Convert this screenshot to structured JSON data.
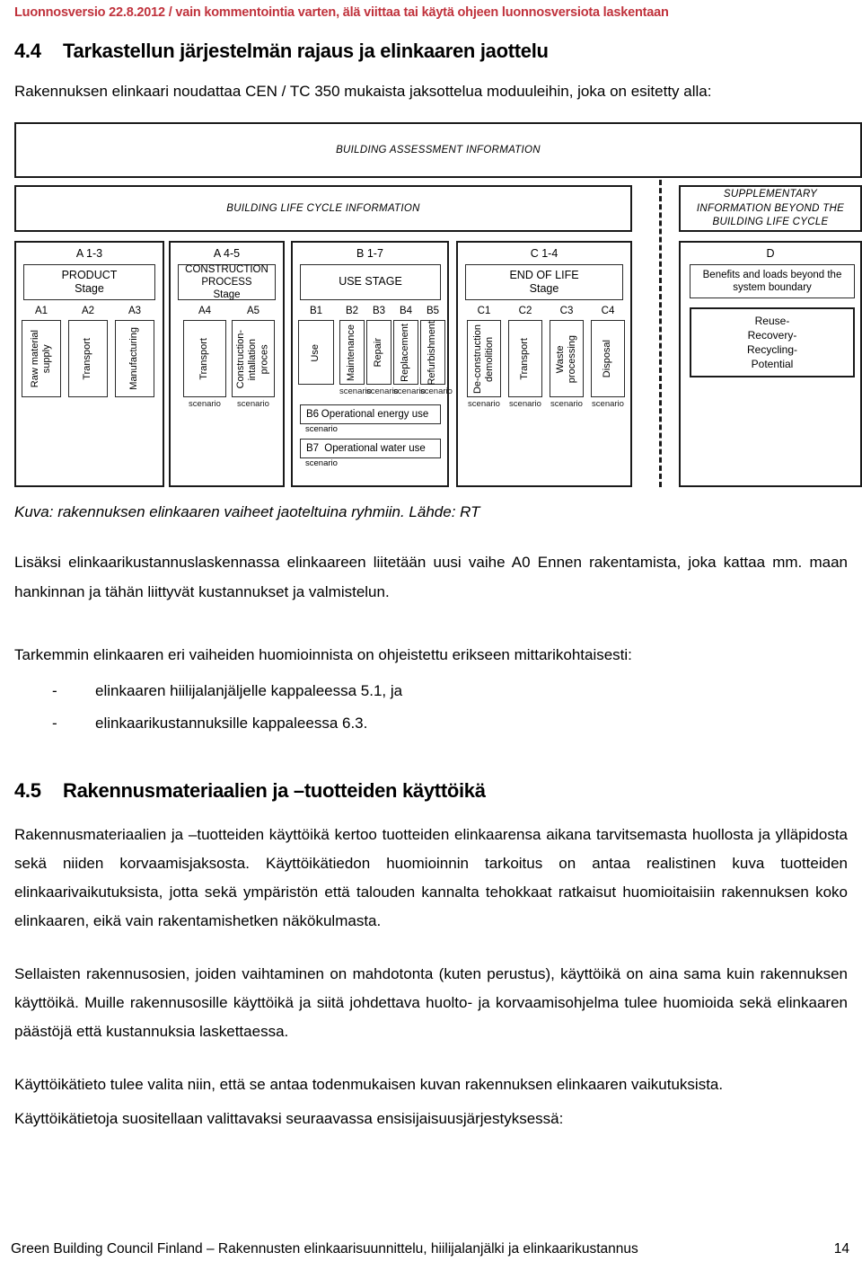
{
  "draft_banner": "Luonnosversio 22.8.2012 / vain kommentointia varten, älä viittaa tai käytä ohjeen luonnosversiota laskentaan",
  "section_44": {
    "number": "4.4",
    "title": "Tarkastellun järjestelmän rajaus ja elinkaaren jaottelu",
    "intro": "Rakennuksen elinkaari noudattaa CEN / TC 350 mukaista jaksottelua moduuleihin, joka on esitetty alla:",
    "caption": "Kuva: rakennuksen elinkaaren vaiheet jaoteltuina ryhmiin. Lähde: RT",
    "para_a0": "Lisäksi elinkaarikustannuslaskennassa elinkaareen liitetään uusi vaihe A0 Ennen rakentamista, joka kattaa mm. maan hankinnan ja tähän liittyvät kustannukset ja valmistelun.",
    "para_metrics": "Tarkemmin elinkaaren eri vaiheiden huomioinnista on ohjeistettu erikseen mittarikohtaisesti:",
    "bullets": [
      {
        "dash": "-",
        "text": "elinkaaren hiilijalanjäljelle kappaleessa 5.1, ja"
      },
      {
        "dash": "-",
        "text": "elinkaarikustannuksille kappaleessa 6.3."
      }
    ]
  },
  "figure": {
    "assessment_header": "BUILDING ASSESSMENT INFORMATION",
    "lifecycle_header": "BUILDING LIFE CYCLE INFORMATION",
    "supplementary_header": "SUPPLEMENTARY\nINFORMATION BEYOND THE\nBUILDING LIFE CYCLE",
    "groups": [
      {
        "code": "A 1-3",
        "stage_title": "PRODUCT\nStage",
        "modules": [
          {
            "code": "A1",
            "label": "Raw material\nsupply",
            "scenario": ""
          },
          {
            "code": "A2",
            "label": "Transport",
            "scenario": ""
          },
          {
            "code": "A3",
            "label": "Manufacturing",
            "scenario": ""
          }
        ]
      },
      {
        "code": "A 4-5",
        "stage_title": "CONSTRUCTION\nPROCESS\nStage",
        "modules": [
          {
            "code": "A4",
            "label": "Transport",
            "scenario": "scenario"
          },
          {
            "code": "A5",
            "label": "Construction-\nintallation\nproces",
            "scenario": "scenario"
          }
        ]
      },
      {
        "code": "B 1-7",
        "stage_title": "USE STAGE",
        "modules": [
          {
            "code": "B1",
            "label": "Use",
            "scenario": ""
          },
          {
            "code": "B2",
            "label": "Maintenance",
            "scenario": "scenario"
          },
          {
            "code": "B3",
            "label": "Repair",
            "scenario": "scenario"
          },
          {
            "code": "B4",
            "label": "Replacement",
            "scenario": "scenario"
          },
          {
            "code": "B5",
            "label": "Refurbishment",
            "scenario": "scenario"
          }
        ],
        "wide_modules": [
          {
            "code": "B6",
            "label": "Operational energy use",
            "scenario": "scenario"
          },
          {
            "code": "B7",
            "label": "Operational water use",
            "scenario": "scenario"
          }
        ]
      },
      {
        "code": "C 1-4",
        "stage_title": "END OF LIFE\nStage",
        "modules": [
          {
            "code": "C1",
            "label": "De-construction\ndemolition",
            "scenario": "scenario"
          },
          {
            "code": "C2",
            "label": "Transport",
            "scenario": "scenario"
          },
          {
            "code": "C3",
            "label": "Waste\nprocessing",
            "scenario": "scenario"
          },
          {
            "code": "C4",
            "label": "Disposal",
            "scenario": "scenario"
          }
        ]
      },
      {
        "code": "D",
        "stage_title": "Benefits and loads beyond the\nsystem boundary",
        "big_box": "Reuse-\nRecovery-\nRecycling-\nPotential"
      }
    ]
  },
  "section_45": {
    "number": "4.5",
    "title": "Rakennusmateriaalien ja –tuotteiden käyttöikä",
    "para1": "Rakennusmateriaalien ja –tuotteiden käyttöikä kertoo tuotteiden elinkaarensa aikana tarvitsemasta huollosta ja ylläpidosta sekä niiden korvaamisjaksosta. Käyttöikätiedon huomioinnin tarkoitus on antaa realistinen kuva tuotteiden elinkaarivaikutuksista, jotta sekä ympäristön että talouden kannalta tehokkaat ratkaisut huomioitaisiin rakennuksen koko elinkaaren, eikä vain rakentamishetken näkökulmasta.",
    "para2": "Sellaisten rakennusosien, joiden vaihtaminen on mahdotonta (kuten perustus), käyttöikä on aina sama kuin rakennuksen käyttöikä. Muille rakennusosille käyttöikä ja siitä johdettava huolto- ja korvaamisohjelma tulee huomioida sekä elinkaaren päästöjä että kustannuksia laskettaessa.",
    "para3": "Käyttöikätieto tulee valita niin, että se antaa todenmukaisen kuvan rakennuksen elinkaaren vaikutuksista.",
    "para4": "Käyttöikätietoja suositellaan valittavaksi seuraavassa ensisijaisuusjärjestyksessä:"
  },
  "footer": {
    "text": "Green Building Council Finland – Rakennusten elinkaarisuunnittelu, hiilijalanjälki ja elinkaarikustannus",
    "page": "14"
  },
  "colors": {
    "draft_red": "#c0323c",
    "ink": "#000000"
  }
}
